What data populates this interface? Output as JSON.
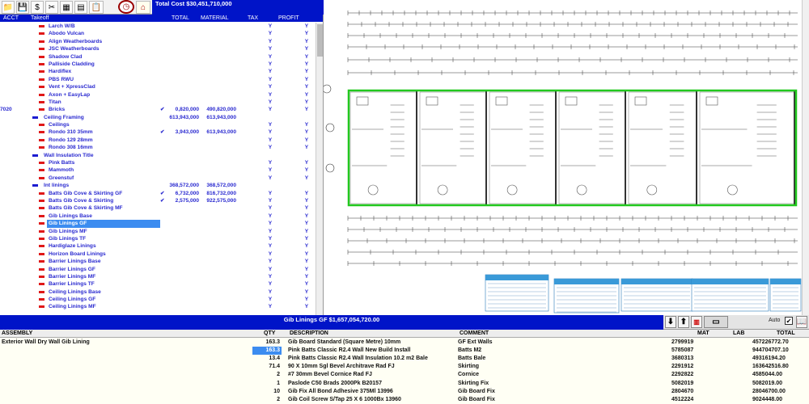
{
  "toolbar": {
    "total_cost": "Total Cost $30,451,710,000",
    "icons": [
      "folder-icon",
      "save-icon",
      "dollar-icon",
      "scissors-icon",
      "spreadsheet-icon",
      "calculator-icon",
      "clipboard-icon",
      "clock-icon",
      "house-icon"
    ]
  },
  "tree": {
    "columns": {
      "acct": "ACCT",
      "takeoff": "Takeoff",
      "total": "TOTAL",
      "material": "MATERIAL",
      "tax": "TAX",
      "profit": "PROFIT"
    },
    "rows": [
      {
        "name": "Larch W/B",
        "level": "child",
        "tax": "Y",
        "profit": "Y"
      },
      {
        "name": "Abodo Vulcan",
        "level": "child",
        "tax": "Y",
        "profit": "Y"
      },
      {
        "name": "Align Weatherboards",
        "level": "child",
        "tax": "Y",
        "profit": "Y"
      },
      {
        "name": "JSC Weatherboards",
        "level": "child",
        "tax": "Y",
        "profit": "Y"
      },
      {
        "name": "Shadow Clad",
        "level": "child",
        "tax": "Y",
        "profit": "Y"
      },
      {
        "name": "Palliside Cladding",
        "level": "child",
        "tax": "Y",
        "profit": "Y"
      },
      {
        "name": "Hardiflex",
        "level": "child",
        "tax": "Y",
        "profit": "Y"
      },
      {
        "name": "PBS RWU",
        "level": "child",
        "tax": "Y",
        "profit": "Y"
      },
      {
        "name": "Vent + XpressClad",
        "level": "child",
        "tax": "Y",
        "profit": "Y"
      },
      {
        "name": "Axon + EasyLap",
        "level": "child",
        "tax": "Y",
        "profit": "Y"
      },
      {
        "name": "Titan",
        "level": "child",
        "tax": "Y",
        "profit": "Y"
      },
      {
        "acct": "7020",
        "name": "Bricks",
        "level": "child",
        "check": "✔",
        "total": "0,820,000",
        "material": "490,820,000",
        "tax": "Y",
        "profit": "Y"
      },
      {
        "name": "Ceiling Framing",
        "level": "group",
        "total": "613,943,000",
        "material": "613,943,000",
        "tax": "",
        "profit": ""
      },
      {
        "name": "Ceilings",
        "level": "child",
        "tax": "Y",
        "profit": "Y"
      },
      {
        "name": "Rondo 310 35mm",
        "level": "child",
        "check": "✔",
        "total": "3,943,000",
        "material": "613,943,000",
        "tax": "Y",
        "profit": "Y"
      },
      {
        "name": "Rondo 129 28mm",
        "level": "child",
        "tax": "Y",
        "profit": "Y"
      },
      {
        "name": "Rondo 308 16mm",
        "level": "child",
        "tax": "Y",
        "profit": "Y"
      },
      {
        "name": "Wall Insulation Title",
        "level": "group",
        "tax": "",
        "profit": ""
      },
      {
        "name": "Pink Batts",
        "level": "child",
        "tax": "Y",
        "profit": "Y"
      },
      {
        "name": "Mammoth",
        "level": "child",
        "tax": "Y",
        "profit": "Y"
      },
      {
        "name": "Greenstuf",
        "level": "child",
        "tax": "Y",
        "profit": "Y"
      },
      {
        "name": "Int linings",
        "level": "group",
        "total": "368,572,000",
        "material": "368,572,000",
        "tax": "",
        "profit": ""
      },
      {
        "name": "Batts Gib Cove & Skirting GF",
        "level": "child",
        "check": "✔",
        "total": "6,732,000",
        "material": "816,732,000",
        "tax": "Y",
        "profit": "Y"
      },
      {
        "name": "Batts Gib Cove & Skirting",
        "level": "child",
        "check": "✔",
        "total": "2,575,000",
        "material": "922,575,000",
        "tax": "Y",
        "profit": "Y"
      },
      {
        "name": "Batts Gib Cove & Skirting MF",
        "level": "child",
        "tax": "Y",
        "profit": "Y"
      },
      {
        "name": "Gib Linings Base",
        "level": "child",
        "tax": "Y",
        "profit": "Y"
      },
      {
        "name": "Gib Linings GF",
        "level": "child",
        "selected": true,
        "tax": "Y",
        "profit": "Y"
      },
      {
        "name": "Gib Linings MF",
        "level": "child",
        "tax": "Y",
        "profit": "Y"
      },
      {
        "name": "Gib Linings TF",
        "level": "child",
        "tax": "Y",
        "profit": "Y"
      },
      {
        "name": "Hardiglaze Linings",
        "level": "child",
        "tax": "Y",
        "profit": "Y"
      },
      {
        "name": "Horizon Board Linings",
        "level": "child",
        "tax": "Y",
        "profit": "Y"
      },
      {
        "name": "Barrier Linings Base",
        "level": "child",
        "tax": "Y",
        "profit": "Y"
      },
      {
        "name": "Barrier Linings GF",
        "level": "child",
        "tax": "Y",
        "profit": "Y"
      },
      {
        "name": "Barrier Linings MF",
        "level": "child",
        "tax": "Y",
        "profit": "Y"
      },
      {
        "name": "Barrier Linings TF",
        "level": "child",
        "tax": "Y",
        "profit": "Y"
      },
      {
        "name": "Ceiling Linings Base",
        "level": "child",
        "tax": "Y",
        "profit": "Y"
      },
      {
        "name": "Ceiling Linings GF",
        "level": "child",
        "tax": "Y",
        "profit": "Y"
      },
      {
        "name": "Ceiling Linings MF",
        "level": "child",
        "tax": "Y",
        "profit": "Y"
      }
    ]
  },
  "assembly_bar": {
    "title": "Gib Linings GF $1,657,054,720.00",
    "auto_label": "Auto",
    "auto_checked": "✔"
  },
  "assembly_table": {
    "columns": {
      "assembly": "ASSEMBLY",
      "qty": "QTY",
      "description": "DESCRIPTION",
      "comment": "COMMENT",
      "mat": "MAT",
      "lab": "LAB",
      "total": "TOTAL"
    },
    "rows": [
      {
        "assembly": "Exterior Wall Dry Wall Gib Lining",
        "qty": "163.3",
        "description": "Gib Board Standard (Square Metre)  10mm",
        "comment": "GF Ext Walls",
        "mat": "2799919",
        "total": "457226772.70"
      },
      {
        "assembly": "",
        "qty": "163.3",
        "description": "Pink Batts Classic R2.4 Wall New Build Install",
        "comment": "Batts M2",
        "mat": "5785087",
        "total": "944704707.10",
        "highlight": true
      },
      {
        "assembly": "",
        "qty": "13.4",
        "description": "Pink Batts Classic R2.4 Wall Insulation 10.2 m2 Bale",
        "comment": "Batts Bale",
        "mat": "3680313",
        "total": "49316194.20"
      },
      {
        "assembly": "",
        "qty": "71.4",
        "description": "90 X 10mm  Sgl Bevel Architrave Rad FJ",
        "comment": "Skirting",
        "mat": "2291912",
        "total": "163642516.80"
      },
      {
        "assembly": "",
        "qty": "2",
        "description": "#7  30mm          Bevel Cornice Rad FJ",
        "comment": "Cornice",
        "mat": "2292822",
        "total": "4585044.00"
      },
      {
        "assembly": "",
        "qty": "1",
        "description": "Paslode C50 Brads 2000Pk              B20157",
        "comment": "Skirting Fix",
        "mat": "5082019",
        "total": "5082019.00"
      },
      {
        "assembly": "",
        "qty": "10",
        "description": "Gib Fix All Bond Adhesive 375Ml  13996",
        "comment": "Gib Board Fix",
        "mat": "2804670",
        "total": "28046700.00"
      },
      {
        "assembly": "",
        "qty": "2",
        "description": "Gib Coil Screw S/Tap 25 X 6 1000Bx    13960",
        "comment": "Gib Board Fix",
        "mat": "4512224",
        "total": "9024448.00"
      }
    ]
  },
  "colors": {
    "title_bar": "#0014c8",
    "tree_text": "#2a2ad0",
    "child_marker": "#e01818",
    "group_marker": "#1c1cd0",
    "selection": "#3c8cf0",
    "wall_outline": "#22c81e",
    "table_bg": "#fffff4"
  }
}
